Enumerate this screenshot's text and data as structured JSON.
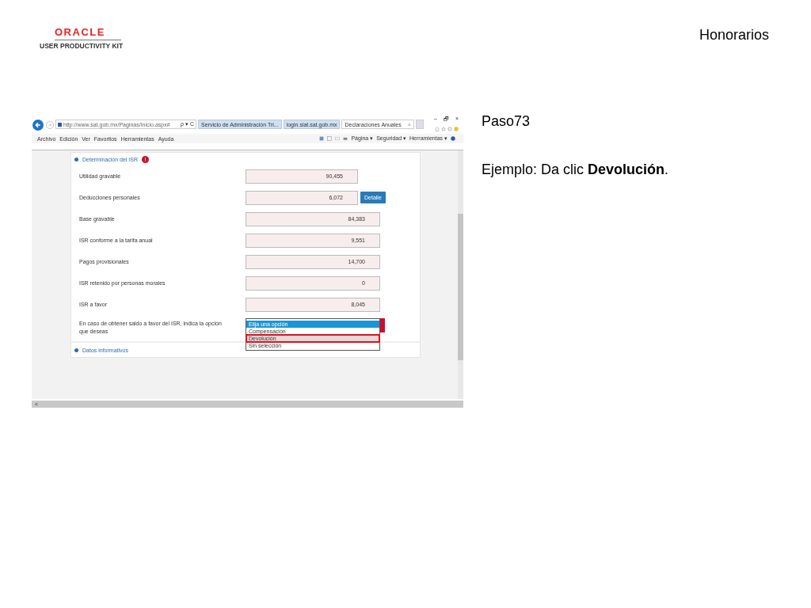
{
  "header": {
    "logo": "ORACLE",
    "product": "USER PRODUCTIVITY KIT",
    "title": "Honorarios"
  },
  "browser": {
    "address": "http://www.sat.gob.mx/Paginas/Inicio.aspx#",
    "address_tools": "ρ ▾ C",
    "tabs": [
      {
        "label": "Servicio de Administración Tri...",
        "selected": false
      },
      {
        "label": "login.siat.sat.gob.mx",
        "selected": false
      },
      {
        "label": "Declaraciones Anuales",
        "selected": true
      }
    ],
    "tab_close": "×",
    "window_controls": [
      "–",
      "🗗",
      "×"
    ],
    "menu": [
      "Archivo",
      "Edición",
      "Ver",
      "Favoritos",
      "Herramientas",
      "Ayuda"
    ],
    "commands": [
      "Página ▾",
      "Seguridad ▾",
      "Herramientas ▾"
    ],
    "scroll_left": "<"
  },
  "panel": {
    "title": "Determinación del ISR",
    "alert": "!",
    "rows": [
      {
        "label": "Utilidad gravable",
        "value": "90,455",
        "kind": "short"
      },
      {
        "label": "Deducciones personales",
        "value": "6,072",
        "kind": "short",
        "button": "Detalle"
      },
      {
        "label": "Base gravable",
        "value": "84,383",
        "kind": "full"
      },
      {
        "label": "ISR conforme a la tarifa anual",
        "value": "9,551",
        "kind": "full"
      },
      {
        "label": "Pagos provisionales",
        "value": "14,700",
        "kind": "full"
      },
      {
        "label": "ISR retenido por personas morales",
        "value": "0",
        "kind": "full"
      },
      {
        "label": "ISR a favor",
        "value": "8,045",
        "kind": "full"
      }
    ],
    "choice_label": "En caso de obtener saldo a favor del ISR, indica la opción que deseas",
    "options": [
      {
        "label": "Elija una opción",
        "selected": true,
        "highlighted": false
      },
      {
        "label": "Compensación",
        "selected": false,
        "highlighted": false
      },
      {
        "label": "Devolución",
        "selected": false,
        "highlighted": true
      },
      {
        "label": "Sin selección",
        "selected": false,
        "highlighted": false
      }
    ],
    "next_section": "Datos informativos"
  },
  "step": {
    "label": "Paso73",
    "instruction": "Ejemplo: Da clic **Devolución**."
  }
}
